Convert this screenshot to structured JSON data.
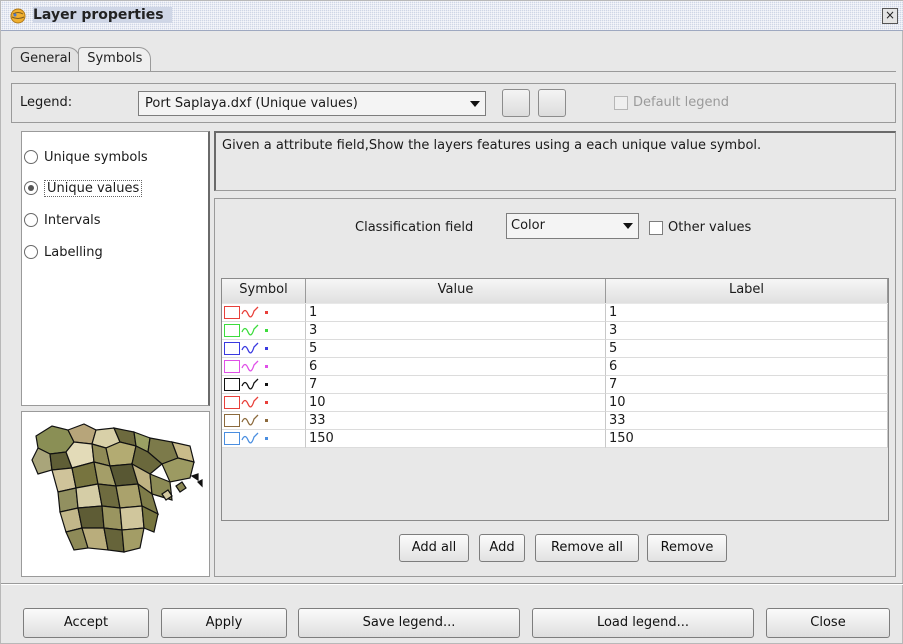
{
  "window": {
    "title": "Layer properties",
    "close_glyph": "×"
  },
  "tabs": [
    {
      "label": "General",
      "active": false
    },
    {
      "label": "Symbols",
      "active": true
    }
  ],
  "legend": {
    "label": "Legend:",
    "selected": "Port Saplaya.dxf (Unique values)",
    "default_legend_label": "Default legend",
    "default_legend_checked": false
  },
  "legend_types": [
    {
      "label": "Unique symbols",
      "selected": false
    },
    {
      "label": "Unique values",
      "selected": true
    },
    {
      "label": "Intervals",
      "selected": false
    },
    {
      "label": "Labelling",
      "selected": false
    }
  ],
  "description": "Given a attribute field,Show the layers features using a each unique value symbol.",
  "classification": {
    "field_label": "Classification field",
    "field_value": "Color",
    "other_values_label": "Other values",
    "other_values_checked": false
  },
  "table": {
    "headers": [
      "Symbol",
      "Value",
      "Label"
    ],
    "rows": [
      {
        "color": "#e8403a",
        "value": "1",
        "label": "1"
      },
      {
        "color": "#3cdc3c",
        "value": "3",
        "label": "3"
      },
      {
        "color": "#3a3ae0",
        "value": "5",
        "label": "5"
      },
      {
        "color": "#e050e8",
        "value": "6",
        "label": "6"
      },
      {
        "color": "#111111",
        "value": "7",
        "label": "7"
      },
      {
        "color": "#e8403a",
        "value": "10",
        "label": "10"
      },
      {
        "color": "#8c6a3c",
        "value": "33",
        "label": "33"
      },
      {
        "color": "#4a8ee0",
        "value": "150",
        "label": "150"
      }
    ]
  },
  "table_buttons": {
    "add_all": "Add all",
    "add": "Add",
    "remove_all": "Remove all",
    "remove": "Remove"
  },
  "footer_buttons": {
    "accept": "Accept",
    "apply": "Apply",
    "save_legend": "Save legend...",
    "load_legend": "Load legend...",
    "close": "Close"
  },
  "icons": {
    "app": "gvsig-globe-icon",
    "close": "close-icon",
    "dropdown": "chevron-down-icon"
  }
}
